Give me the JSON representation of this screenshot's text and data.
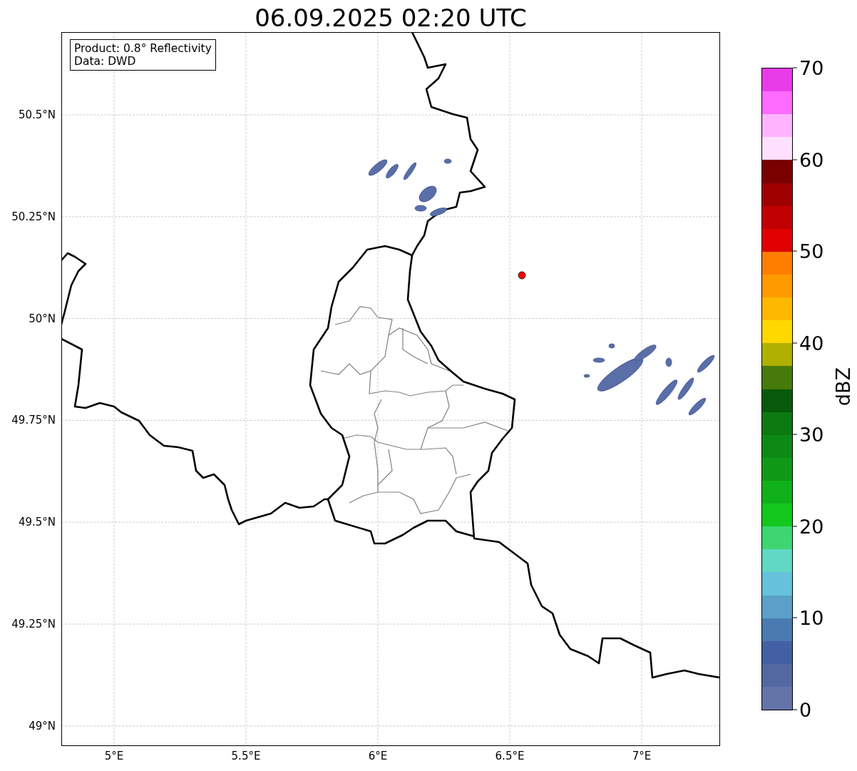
{
  "title": "06.09.2025 02:20 UTC",
  "info_box": {
    "lines": [
      "Product: 0.8° Reflectivity",
      "Data: DWD"
    ]
  },
  "map": {
    "y_ticks": [
      "50.5°N",
      "50.25°N",
      "50°N",
      "49.75°N",
      "49.5°N",
      "49.25°N",
      "49°N"
    ],
    "x_ticks": [
      "5°E",
      "5.5°E",
      "6°E",
      "6.5°E",
      "7°E"
    ]
  },
  "colorbar": {
    "label": "dBZ",
    "ticks": [
      "70",
      "60",
      "50",
      "40",
      "30",
      "20",
      "10",
      "0"
    ],
    "segments": [
      {
        "color": "#e83ce8"
      },
      {
        "color": "#ff6cff"
      },
      {
        "color": "#ffb4ff"
      },
      {
        "color": "#ffe0ff"
      },
      {
        "color": "#7a0000"
      },
      {
        "color": "#a00000"
      },
      {
        "color": "#c00000"
      },
      {
        "color": "#e00000"
      },
      {
        "color": "#ff7e00"
      },
      {
        "color": "#ff9a00"
      },
      {
        "color": "#ffb800"
      },
      {
        "color": "#ffd800"
      },
      {
        "color": "#b0b000"
      },
      {
        "color": "#467a0a"
      },
      {
        "color": "#075a0a"
      },
      {
        "color": "#0b7a10"
      },
      {
        "color": "#0c8a14"
      },
      {
        "color": "#0e9a16"
      },
      {
        "color": "#10b01a"
      },
      {
        "color": "#12c81c"
      },
      {
        "color": "#3dd672"
      },
      {
        "color": "#60d8c4"
      },
      {
        "color": "#66c2dc"
      },
      {
        "color": "#5aa0c8"
      },
      {
        "color": "#4a7ab0"
      },
      {
        "color": "#4460a4"
      },
      {
        "color": "#5468a0"
      },
      {
        "color": "#6473a8"
      }
    ]
  }
}
